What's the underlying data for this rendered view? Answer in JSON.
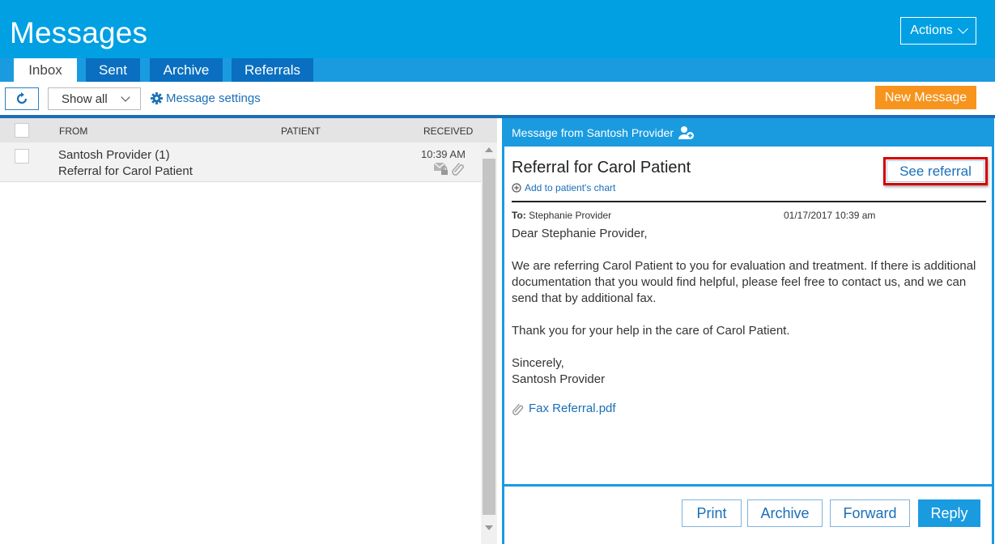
{
  "app": {
    "title": "Messages",
    "actions_label": "Actions"
  },
  "tabs": [
    {
      "label": "Inbox",
      "active": true
    },
    {
      "label": "Sent",
      "active": false
    },
    {
      "label": "Archive",
      "active": false
    },
    {
      "label": "Referrals",
      "active": false
    }
  ],
  "toolbar": {
    "filter_value": "Show all",
    "settings_label": "Message settings",
    "new_message_label": "New Message"
  },
  "list": {
    "columns": {
      "from": "FROM",
      "patient": "PATIENT",
      "received": "RECEIVED"
    },
    "rows": [
      {
        "from": "Santosh Provider (1)",
        "subject": "Referral for Carol Patient",
        "patient": "",
        "received": "10:39 AM"
      }
    ]
  },
  "message": {
    "frame_title": "Message from Santosh Provider",
    "subject": "Referral for Carol Patient",
    "add_to_chart": "Add to patient's chart",
    "see_referral": "See referral",
    "to_label": "To:",
    "to_value": "Stephanie Provider",
    "date": "01/17/2017 10:39 am",
    "greeting": "Dear Stephanie Provider,",
    "paragraph1": "We are referring Carol Patient to you for evaluation and treatment. If there is additional documentation that you would find helpful, please feel free to contact us, and we can send that by additional fax.",
    "paragraph2": "Thank you for your help in the care of Carol Patient.",
    "closing": "Sincerely,",
    "signature": "Santosh Provider",
    "attachment": "Fax Referral.pdf"
  },
  "footer": {
    "print": "Print",
    "archive": "Archive",
    "forward": "Forward",
    "reply": "Reply"
  },
  "colors": {
    "header_blue": "#00a0e3",
    "tab_dark": "#0a6fc0",
    "link_blue": "#1a6fb8",
    "accent_orange": "#f7941d",
    "highlight_red": "#d40000"
  },
  "icons": [
    "refresh-icon",
    "chevron-down-icon",
    "gear-icon",
    "add-contact-icon",
    "plus-circle-icon",
    "envelope-lock-icon",
    "paperclip-icon"
  ]
}
